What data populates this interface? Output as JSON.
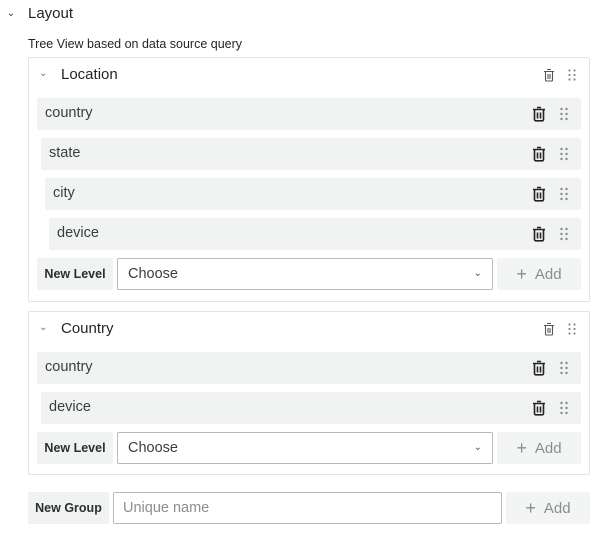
{
  "section": {
    "title": "Layout",
    "expanded": true,
    "description": "Tree View based on data source query"
  },
  "groups": [
    {
      "name": "Location",
      "expanded": true,
      "levels": [
        {
          "label": "country"
        },
        {
          "label": "state"
        },
        {
          "label": "city"
        },
        {
          "label": "device"
        }
      ],
      "new_level": {
        "label": "New Level",
        "select_value": "Choose",
        "add_label": "Add"
      }
    },
    {
      "name": "Country",
      "expanded": true,
      "levels": [
        {
          "label": "country"
        },
        {
          "label": "device"
        }
      ],
      "new_level": {
        "label": "New Level",
        "select_value": "Choose",
        "add_label": "Add"
      }
    }
  ],
  "new_group": {
    "label": "New Group",
    "placeholder": "Unique name",
    "value": "",
    "add_label": "Add"
  },
  "icons": {
    "section_chevron": "chevron-down-icon",
    "group_chevron": "chevron-down-icon",
    "delete": "trash-icon",
    "drag": "drag-handle-icon",
    "add": "plus-icon"
  }
}
